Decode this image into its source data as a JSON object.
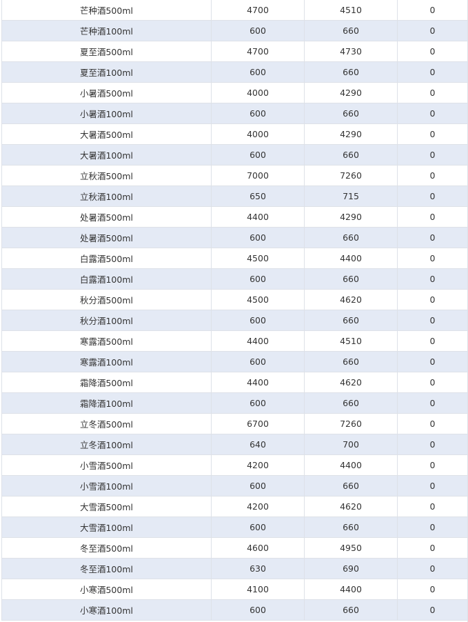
{
  "rows": [
    {
      "name": "芒种酒500ml",
      "a": "4700",
      "b": "4510",
      "c": "0"
    },
    {
      "name": "芒种酒100ml",
      "a": "600",
      "b": "660",
      "c": "0"
    },
    {
      "name": "夏至酒500ml",
      "a": "4700",
      "b": "4730",
      "c": "0"
    },
    {
      "name": "夏至酒100ml",
      "a": "600",
      "b": "660",
      "c": "0"
    },
    {
      "name": "小暑酒500ml",
      "a": "4000",
      "b": "4290",
      "c": "0"
    },
    {
      "name": "小暑酒100ml",
      "a": "600",
      "b": "660",
      "c": "0"
    },
    {
      "name": "大暑酒500ml",
      "a": "4000",
      "b": "4290",
      "c": "0"
    },
    {
      "name": "大暑酒100ml",
      "a": "600",
      "b": "660",
      "c": "0"
    },
    {
      "name": "立秋酒500ml",
      "a": "7000",
      "b": "7260",
      "c": "0"
    },
    {
      "name": "立秋酒100ml",
      "a": "650",
      "b": "715",
      "c": "0"
    },
    {
      "name": "处暑酒500ml",
      "a": "4400",
      "b": "4290",
      "c": "0"
    },
    {
      "name": "处暑酒500ml",
      "a": "600",
      "b": "660",
      "c": "0"
    },
    {
      "name": "白露酒500ml",
      "a": "4500",
      "b": "4400",
      "c": "0"
    },
    {
      "name": "白露酒100ml",
      "a": "600",
      "b": "660",
      "c": "0"
    },
    {
      "name": "秋分酒500ml",
      "a": "4500",
      "b": "4620",
      "c": "0"
    },
    {
      "name": "秋分酒100ml",
      "a": "600",
      "b": "660",
      "c": "0"
    },
    {
      "name": "寒露酒500ml",
      "a": "4400",
      "b": "4510",
      "c": "0"
    },
    {
      "name": "寒露酒100ml",
      "a": "600",
      "b": "660",
      "c": "0"
    },
    {
      "name": "霜降酒500ml",
      "a": "4400",
      "b": "4620",
      "c": "0"
    },
    {
      "name": "霜降酒100ml",
      "a": "600",
      "b": "660",
      "c": "0"
    },
    {
      "name": "立冬酒500ml",
      "a": "6700",
      "b": "7260",
      "c": "0"
    },
    {
      "name": "立冬酒100ml",
      "a": "640",
      "b": "700",
      "c": "0"
    },
    {
      "name": "小雪酒500ml",
      "a": "4200",
      "b": "4400",
      "c": "0"
    },
    {
      "name": "小雪酒100ml",
      "a": "600",
      "b": "660",
      "c": "0"
    },
    {
      "name": "大雪酒500ml",
      "a": "4200",
      "b": "4620",
      "c": "0"
    },
    {
      "name": "大雪酒100ml",
      "a": "600",
      "b": "660",
      "c": "0"
    },
    {
      "name": "冬至酒500ml",
      "a": "4600",
      "b": "4950",
      "c": "0"
    },
    {
      "name": "冬至酒100ml",
      "a": "630",
      "b": "690",
      "c": "0"
    },
    {
      "name": "小寒酒500ml",
      "a": "4100",
      "b": "4400",
      "c": "0"
    },
    {
      "name": "小寒酒100ml",
      "a": "600",
      "b": "660",
      "c": "0"
    }
  ]
}
